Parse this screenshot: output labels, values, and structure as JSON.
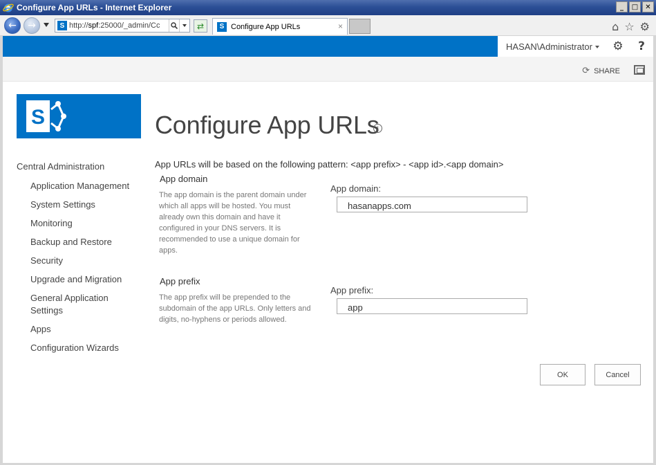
{
  "window": {
    "title": "Configure App URLs - Internet Explorer",
    "minimize": "_",
    "maximize": "□",
    "close": "✕"
  },
  "browser": {
    "address_prefix": "http://",
    "address_host": "spf",
    "address_rest": ":25000/_admin/Cc",
    "tab_title": "Configure App URLs",
    "tab_close": "×",
    "sp_glyph": "S"
  },
  "suitebar": {
    "user": "HASAN\\Administrator",
    "help": "?"
  },
  "ribbon": {
    "share": "SHARE"
  },
  "page": {
    "title": "Configure App URLs",
    "info": "i",
    "pattern_text": "App URLs will be based on the following pattern: <app prefix> - <app id>.<app domain>"
  },
  "leftnav": {
    "heading": "Central Administration",
    "items": [
      "Application Management",
      "System Settings",
      "Monitoring",
      "Backup and Restore",
      "Security",
      "Upgrade and Migration",
      "General Application Settings",
      "Apps",
      "Configuration Wizards"
    ]
  },
  "app_domain": {
    "section_title": "App domain",
    "description": "The app domain is the parent domain under which all apps will be hosted. You must already own this domain and have it configured in your DNS servers. It is recommended to use a unique domain for apps.",
    "field_label": "App domain:",
    "value": "hasanapps.com"
  },
  "app_prefix": {
    "section_title": "App prefix",
    "description": "The app prefix will be prepended to the subdomain of the app URLs. Only letters and digits, no-hyphens or periods allowed.",
    "field_label": "App prefix:",
    "value": "app"
  },
  "buttons": {
    "ok": "OK",
    "cancel": "Cancel"
  },
  "colors": {
    "suite_blue": "#0072c6",
    "title_bar": "#2c4f96"
  }
}
